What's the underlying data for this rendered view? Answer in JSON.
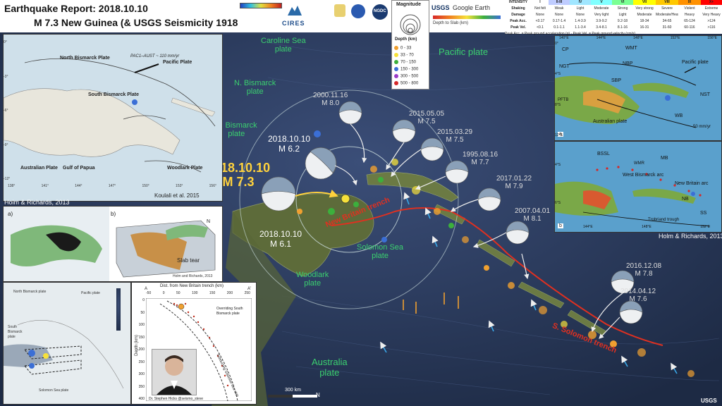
{
  "header": {
    "title_line1": "Earthquake Report: 2018.10.10",
    "title_line2": "M 7.3 New Guinea (& USGS Seismicity 1918-2018 M ≥ 7.5)"
  },
  "logos": {
    "cires": "CIRES",
    "usgs_google": "Google Earth",
    "usgs": "USGS",
    "ngdc": "NGDC"
  },
  "legend": {
    "title": "Magnitude",
    "depth_title": "Depth (km)",
    "depths": [
      {
        "label": "0 - 33",
        "color": "#f0a030"
      },
      {
        "label": "33 - 70",
        "color": "#f6e13a"
      },
      {
        "label": "70 - 150",
        "color": "#3cb03c"
      },
      {
        "label": "150 - 300",
        "color": "#3b6fd6"
      },
      {
        "label": "300 - 500",
        "color": "#9b3cc8"
      },
      {
        "label": "500 - 800",
        "color": "#d62828"
      }
    ],
    "depth_to_slab": "Depth to Slab (km)"
  },
  "intensity_table": {
    "headers": [
      "INTENSITY",
      "I",
      "II-III",
      "IV",
      "V",
      "VI",
      "VII",
      "VIII",
      "IX",
      "X+"
    ],
    "rows": [
      {
        "label": "Shaking",
        "cells": [
          "Not felt",
          "Weak",
          "Light",
          "Moderate",
          "Strong",
          "Very strong",
          "Severe",
          "Violent",
          "Extreme"
        ]
      },
      {
        "label": "Damage",
        "cells": [
          "None",
          "None",
          "None",
          "Very light",
          "Light",
          "Moderate",
          "Moderate/Heavy",
          "Heavy",
          "Very Heavy"
        ]
      },
      {
        "label": "Peak Acc.",
        "cells": [
          "<0.17",
          "0.17-1.4",
          "1.4-3.9",
          "3.9-9.2",
          "9.2-18",
          "18-34",
          "34-65",
          "65-124",
          ">124"
        ]
      },
      {
        "label": "Peak Vel.",
        "cells": [
          "<0.1",
          "0.1-1.1",
          "1.1-3.4",
          "3.4-8.1",
          "8.1-16",
          "16-31",
          "31-60",
          "60-116",
          ">116"
        ]
      }
    ],
    "footnote": "Peak Acc. = Peak ground acceleration (g) · Peak Vel. = Peak ground velocity (cm/s)"
  },
  "map_labels": {
    "caroline": "Caroline Sea\nplate",
    "pacific": "Pacific plate",
    "n_bismarck": "N. Bismarck\nplate",
    "s_bismarck": "S. Bismarck\nplate",
    "solomon": "Solomon Sea\nplate",
    "woodlark": "Woodlark\nplate",
    "australia": "Australia\nplate",
    "new_britain_trench": "New Britain trench",
    "s_solomon_trench": "S. Solomon trench",
    "scale": "300 km",
    "north": "N"
  },
  "events": {
    "main": {
      "date": "2018.10.10",
      "mag": "M 7.3"
    },
    "e62": {
      "date": "2018.10.10",
      "mag": "M 6.2"
    },
    "e61": {
      "date": "2018.10.10",
      "mag": "M 6.1"
    },
    "e2000": {
      "date": "2000.11.16",
      "mag": "M 8.0"
    },
    "e2015a": {
      "date": "2015.05.05",
      "mag": "M 7.5"
    },
    "e2015b": {
      "date": "2015.03.29",
      "mag": "M 7.5"
    },
    "e1995": {
      "date": "1995.08.16",
      "mag": "M 7.7"
    },
    "e2017": {
      "date": "2017.01.22",
      "mag": "M 7.9"
    },
    "e2007": {
      "date": "2007.04.01",
      "mag": "M 8.1"
    },
    "e2016": {
      "date": "2016.12.08",
      "mag": "M 7.8"
    },
    "e2014": {
      "date": "2014.04.12",
      "mag": "M 7.6"
    }
  },
  "inset_tl": {
    "caption": "Koulali et al. 2015",
    "pacific_label": "Pacific Plate",
    "vel_label": "PAC1–AUST ~ 110 mm/yr",
    "north_bismarck": "North Bismarck Plate",
    "south_bismarck": "South Bismarck Plate",
    "australian": "Australian Plate",
    "gulf": "Gulf of Papua",
    "woodlark": "Woodlark Plate",
    "lon_ticks": [
      "138°",
      "141°",
      "144°",
      "147°",
      "150°",
      "153°",
      "156°"
    ],
    "lat_ticks": [
      "0°",
      "-3°",
      "-6°",
      "-9°",
      "-12°"
    ]
  },
  "inset_ml": {
    "caption_top": "Holm & Richards, 2013",
    "label_a": "a)",
    "label_b": "b)",
    "slab_tear": "Slab tear",
    "caption_bottom": "Holm and Richards, 2013",
    "north": "N"
  },
  "inset_bl": {
    "north_bismarck": "North Bismarck plate",
    "pacific": "Pacific plate",
    "south_bismarck": "South\nBismarck\nplate",
    "solomon": "Solomon Sea plate"
  },
  "inset_profile": {
    "title": "Dist. from New Britain trench (km)",
    "a_label": "A",
    "a_prime": "A'",
    "x_ticks": [
      "-50",
      "0",
      "50",
      "100",
      "150",
      "200",
      "250"
    ],
    "y_ticks": [
      "0",
      "50",
      "100",
      "150",
      "200",
      "250",
      "300",
      "350",
      "400"
    ],
    "ylabel": "Depth (km)",
    "overriding": "Overriding South\nBismarck plate",
    "slab": "Subducting Solomon Sea slab",
    "credit": "Dr. Stephen Hicks @seismo_steve"
  },
  "inset_tr": {
    "panel_a": "a",
    "panel_b": "b",
    "cp": "CP",
    "wmt": "WMT",
    "nbp": "NBP",
    "ngt": "NGT",
    "sbp": "SBP",
    "pacific": "Pacific plate",
    "nst": "NST",
    "australian": "Australian plate",
    "wb": "WB",
    "scale": "50 mm/yr",
    "pftb": "PFTB",
    "lon_ticks_top": [
      "140°E",
      "144°E",
      "148°E",
      "152°E",
      "156°E"
    ],
    "lat_ticks_top": [
      "0°",
      "4°S",
      "8°S",
      "12°S"
    ],
    "bssl": "BSSL",
    "mb": "MB",
    "wmr": "WMR",
    "west_bismarck": "West Bismarck arc",
    "new_britain_arc": "New Britain arc",
    "nb": "NB",
    "ss": "SS",
    "trobriand": "Trobriand trough",
    "lon_ticks_bottom": [
      "144°E",
      "148°E",
      "152°E"
    ],
    "lat_ticks_bottom": [
      "4°S",
      "6°S"
    ],
    "caption": "Holm & Richards, 2013"
  },
  "colors": {
    "ocean": "#2a3a58",
    "land": "#5d6b3a",
    "header_bg": "#ffffff",
    "main_title_yellow": "#ffd23c",
    "trench_red": "#e03020",
    "plate_green": "#3bd16f"
  }
}
